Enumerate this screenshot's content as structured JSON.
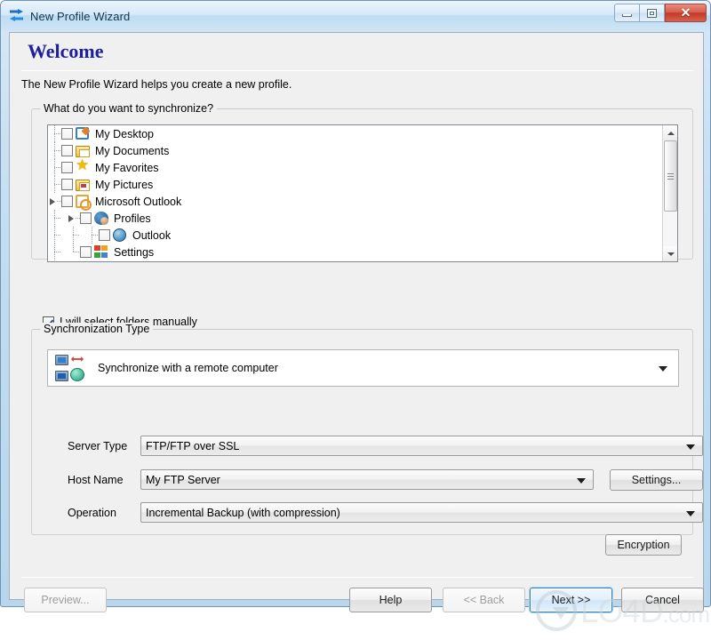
{
  "window": {
    "title": "New Profile Wizard",
    "app_icon": "sync-arrows-icon",
    "minimize_label": "Minimize",
    "maximize_label": "Maximize",
    "close_label": "✕"
  },
  "header": {
    "heading": "Welcome",
    "intro": "The New Profile Wizard helps you create a new profile."
  },
  "sync_group": {
    "legend": "What do you want to synchronize?",
    "tree": [
      {
        "label": "My Desktop",
        "icon": "desktop-icon",
        "depth": 0,
        "checked": false,
        "expandable": false
      },
      {
        "label": "My Documents",
        "icon": "folder-documents-icon",
        "depth": 0,
        "checked": false,
        "expandable": false
      },
      {
        "label": "My Favorites",
        "icon": "star-favorites-icon",
        "depth": 0,
        "checked": false,
        "expandable": false
      },
      {
        "label": "My Pictures",
        "icon": "folder-pictures-icon",
        "depth": 0,
        "checked": false,
        "expandable": false
      },
      {
        "label": "Microsoft Outlook",
        "icon": "outlook-clock-icon",
        "depth": 0,
        "checked": false,
        "expandable": true
      },
      {
        "label": "Profiles",
        "icon": "profiles-user-icon",
        "depth": 1,
        "checked": false,
        "expandable": true
      },
      {
        "label": "Outlook",
        "icon": "globe-icon",
        "depth": 2,
        "checked": false,
        "expandable": false
      },
      {
        "label": "Settings",
        "icon": "settings-blocks-icon",
        "depth": 1,
        "checked": false,
        "expandable": false
      }
    ],
    "manual_checkbox": {
      "label": "I will select folders manually",
      "checked": true
    }
  },
  "type_group": {
    "legend": "Synchronization Type",
    "sync_target": {
      "value": "Synchronize with a remote computer",
      "icon": "two-computers-network-icon"
    },
    "fields": [
      {
        "label": "Server Type",
        "value": "FTP/FTP over SSL"
      },
      {
        "label": "Host Name",
        "value": "My FTP Server"
      },
      {
        "label": "Operation",
        "value": "Incremental Backup (with compression)"
      }
    ],
    "settings_button": "Settings...",
    "encryption_button": "Encryption"
  },
  "footer": {
    "preview": "Preview...",
    "help": "Help",
    "back": "<< Back",
    "next": "Next >>",
    "cancel": "Cancel"
  },
  "watermark": {
    "text_main": "LO4D",
    "text_suffix": ".com"
  },
  "colors": {
    "heading": "#1f1f9c",
    "titlebar_text": "#14334f",
    "close_button": "#c23a29",
    "focus_ring": "#3c7fb1"
  }
}
